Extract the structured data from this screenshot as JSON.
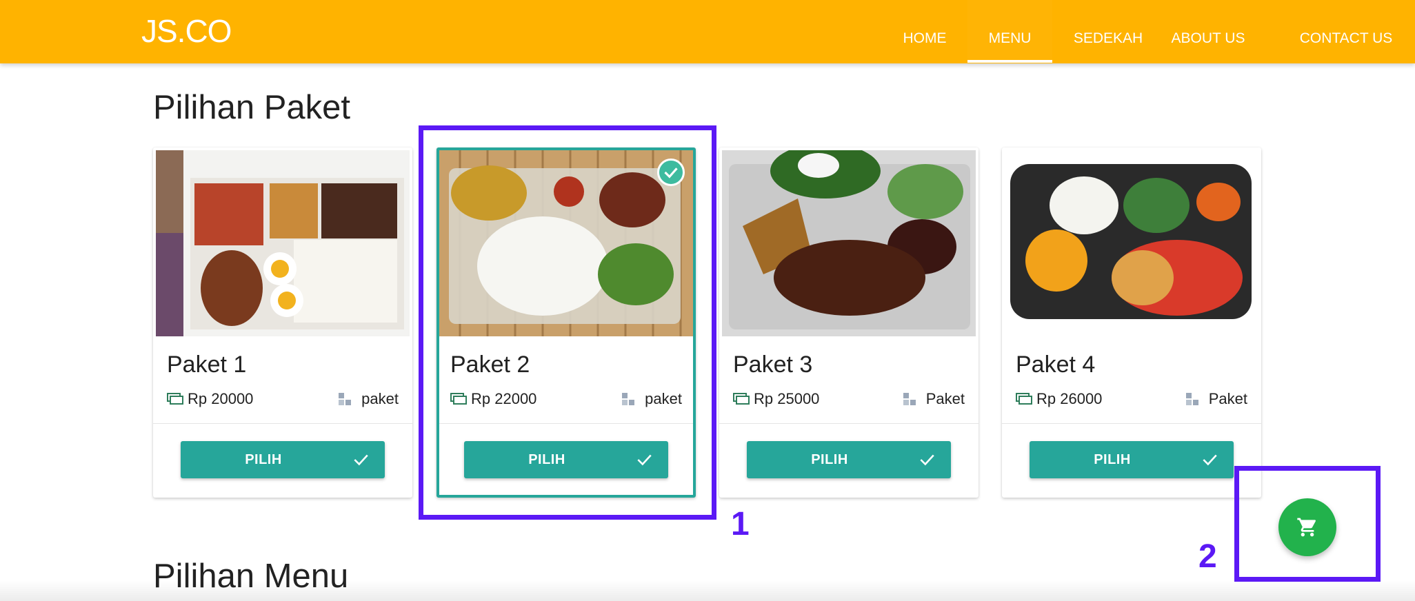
{
  "navbar": {
    "brand": "JS.CO",
    "items": [
      {
        "label": "HOME",
        "active": false
      },
      {
        "label": "MENU",
        "active": true
      },
      {
        "label": "SEDEKAH",
        "active": false
      },
      {
        "label": "ABOUT US",
        "active": false
      },
      {
        "label": "CONTACT US",
        "active": false
      }
    ]
  },
  "sections": {
    "paket_title": "Pilihan Paket",
    "menu_title": "Pilihan Menu"
  },
  "cards": [
    {
      "title": "Paket 1",
      "price": "Rp 20000",
      "unit": "paket",
      "button": "PILIH",
      "selected": false,
      "image": "food-box-chicken-egg-rice"
    },
    {
      "title": "Paket 2",
      "price": "Rp 22000",
      "unit": "paket",
      "button": "PILIH",
      "selected": true,
      "image": "food-tray-rice-rendang-beans"
    },
    {
      "title": "Paket 3",
      "price": "Rp 25000",
      "unit": "Paket",
      "button": "PILIH",
      "selected": false,
      "image": "food-plate-fried-fish-tempeh"
    },
    {
      "title": "Paket 4",
      "price": "Rp 26000",
      "unit": "Paket",
      "button": "PILIH",
      "selected": false,
      "image": "food-tray-rice-chicken-veg"
    }
  ],
  "annotations": [
    {
      "label": "1",
      "target": "paket-2-card"
    },
    {
      "label": "2",
      "target": "cart-button"
    }
  ],
  "colors": {
    "navbar": "#ffb300",
    "accent": "#26a69a",
    "fab": "#22b24c",
    "annotation": "#5b19f5"
  },
  "icons": {
    "price": "money-icon",
    "unit": "package-icon",
    "button": "check-icon",
    "fab": "cart-icon"
  }
}
